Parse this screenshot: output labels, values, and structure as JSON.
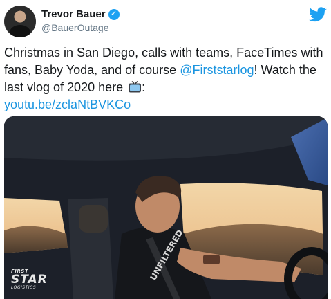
{
  "author": {
    "display_name": "Trevor Bauer",
    "handle": "@BauerOutage",
    "verified": true
  },
  "icons": {
    "avatar": "profile-photo",
    "verified": "verified-badge-icon",
    "logo": "twitter-bird-icon",
    "emoji": "television-icon"
  },
  "tweet": {
    "text_part1": "Christmas in San Diego, calls with teams, FaceTimes with fans, Baby Yoda, and of course ",
    "mention": "@Firststarlog",
    "text_part2": "! Watch the last vlog of 2020 here ",
    "text_part3": ":",
    "link": "youtu.be/zclaNtBVKCo"
  },
  "media": {
    "watermark_top": "FIRST",
    "watermark_main": "STAR",
    "watermark_bottom": "LOGISTICS",
    "shirt_text": "UNFILTERED"
  },
  "colors": {
    "link": "#1b95e0",
    "twitter_blue": "#1da1f2",
    "secondary_text": "#657786"
  }
}
